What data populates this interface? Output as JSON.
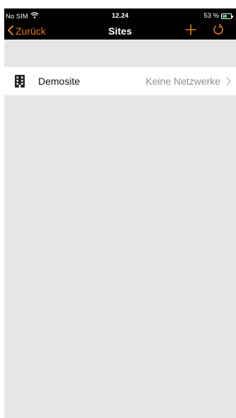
{
  "status_bar": {
    "carrier": "No SIM",
    "time": "12.24",
    "battery_percent": "53 %",
    "battery_level": 0.53,
    "icons": [
      "wifi-icon",
      "battery-charging-icon"
    ]
  },
  "nav_bar": {
    "back_label": "Zurück",
    "title": "Sites",
    "actions": [
      "add-icon",
      "refresh-icon"
    ]
  },
  "sites": [
    {
      "name": "Demosite",
      "detail": "Keine Netzwerke",
      "icon": "building-icon"
    }
  ],
  "colors": {
    "accent": "#e07a1a",
    "nav_background": "#000000",
    "list_background": "#e6e6e6",
    "detail_text": "#8e8e93",
    "battery_fill": "#4cd964"
  }
}
